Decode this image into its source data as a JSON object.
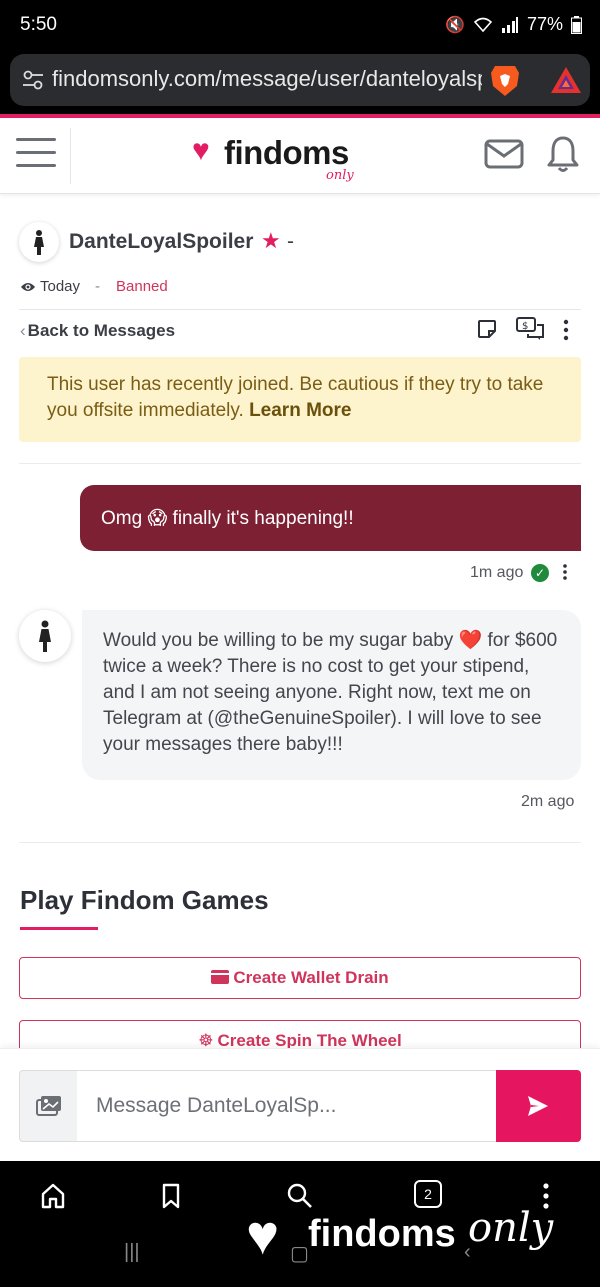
{
  "status_bar": {
    "time": "5:50",
    "battery": "77%"
  },
  "browser": {
    "url": "findomsonly.com/message/user/danteloyalspoiler"
  },
  "header": {
    "logo_text": "findoms",
    "logo_sub": "only"
  },
  "conversation": {
    "username": "DanteLoyalSpoiler",
    "name_suffix": "-",
    "last_seen": "Today",
    "separator": "-",
    "status": "Banned",
    "back_label": "Back to Messages"
  },
  "warning": {
    "text": "This user has recently joined. Be cautious if they try to take you offsite immediately.",
    "link": "Learn More"
  },
  "messages": [
    {
      "direction": "sent",
      "text": "Omg 😱 finally it's happening!!",
      "time": "1m ago"
    },
    {
      "direction": "received",
      "text": "Would you be willing to be my sugar baby ❤️ for $600 twice a week? There is no cost to get your stipend, and I am not seeing anyone. Right now, text me on Telegram at (@theGenuineSpoiler). I will love to see your messages there baby!!!",
      "time": "2m ago"
    }
  ],
  "games": {
    "title": "Play Findom Games",
    "buttons": [
      {
        "label": "Create Wallet Drain",
        "icon": "wallet-icon"
      },
      {
        "label": "Create Spin The Wheel",
        "icon": "wheel-icon"
      }
    ]
  },
  "composer": {
    "placeholder": "Message DanteLoyalSp..."
  },
  "bottom_bar": {
    "tab_count": "2",
    "watermark_text": "findoms",
    "watermark_sub": "only"
  },
  "colors": {
    "brand_pink": "#e11d63",
    "sent_bubble": "#7e2033",
    "warning_bg": "#fdf3cd",
    "read_check": "#1f8a3b"
  }
}
